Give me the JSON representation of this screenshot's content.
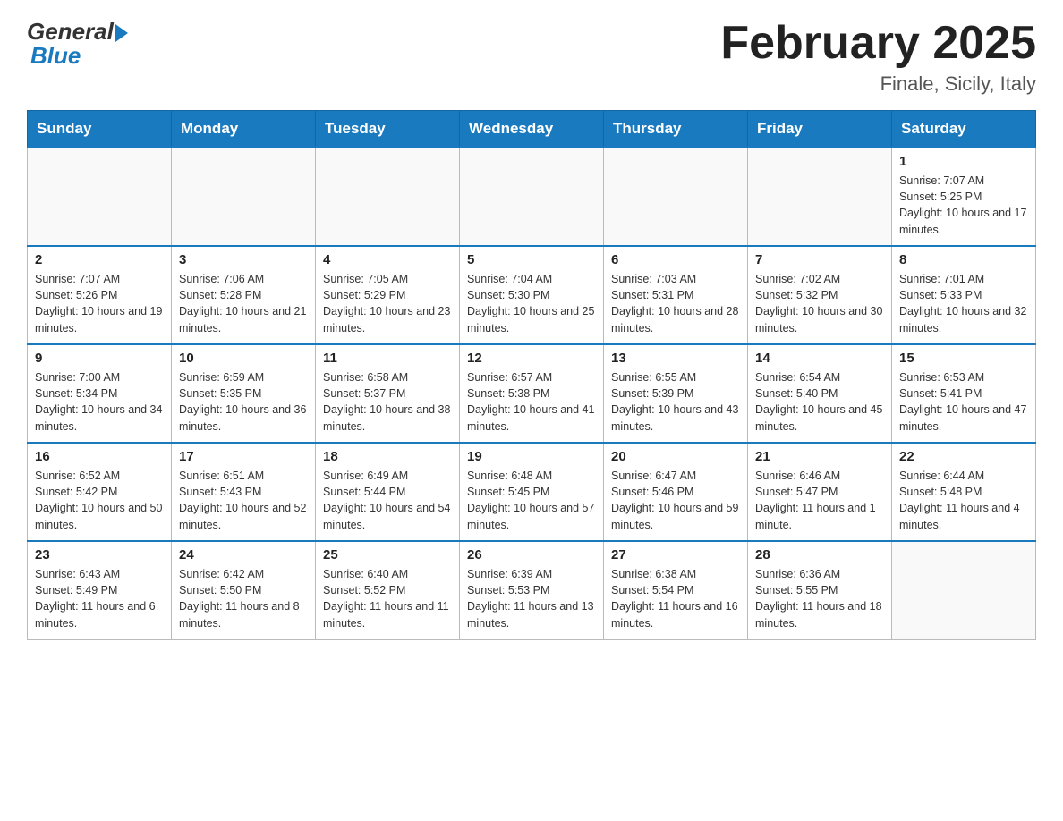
{
  "logo": {
    "general": "General",
    "blue": "Blue"
  },
  "title": "February 2025",
  "location": "Finale, Sicily, Italy",
  "days_of_week": [
    "Sunday",
    "Monday",
    "Tuesday",
    "Wednesday",
    "Thursday",
    "Friday",
    "Saturday"
  ],
  "weeks": [
    [
      {
        "day": "",
        "info": ""
      },
      {
        "day": "",
        "info": ""
      },
      {
        "day": "",
        "info": ""
      },
      {
        "day": "",
        "info": ""
      },
      {
        "day": "",
        "info": ""
      },
      {
        "day": "",
        "info": ""
      },
      {
        "day": "1",
        "info": "Sunrise: 7:07 AM\nSunset: 5:25 PM\nDaylight: 10 hours and 17 minutes."
      }
    ],
    [
      {
        "day": "2",
        "info": "Sunrise: 7:07 AM\nSunset: 5:26 PM\nDaylight: 10 hours and 19 minutes."
      },
      {
        "day": "3",
        "info": "Sunrise: 7:06 AM\nSunset: 5:28 PM\nDaylight: 10 hours and 21 minutes."
      },
      {
        "day": "4",
        "info": "Sunrise: 7:05 AM\nSunset: 5:29 PM\nDaylight: 10 hours and 23 minutes."
      },
      {
        "day": "5",
        "info": "Sunrise: 7:04 AM\nSunset: 5:30 PM\nDaylight: 10 hours and 25 minutes."
      },
      {
        "day": "6",
        "info": "Sunrise: 7:03 AM\nSunset: 5:31 PM\nDaylight: 10 hours and 28 minutes."
      },
      {
        "day": "7",
        "info": "Sunrise: 7:02 AM\nSunset: 5:32 PM\nDaylight: 10 hours and 30 minutes."
      },
      {
        "day": "8",
        "info": "Sunrise: 7:01 AM\nSunset: 5:33 PM\nDaylight: 10 hours and 32 minutes."
      }
    ],
    [
      {
        "day": "9",
        "info": "Sunrise: 7:00 AM\nSunset: 5:34 PM\nDaylight: 10 hours and 34 minutes."
      },
      {
        "day": "10",
        "info": "Sunrise: 6:59 AM\nSunset: 5:35 PM\nDaylight: 10 hours and 36 minutes."
      },
      {
        "day": "11",
        "info": "Sunrise: 6:58 AM\nSunset: 5:37 PM\nDaylight: 10 hours and 38 minutes."
      },
      {
        "day": "12",
        "info": "Sunrise: 6:57 AM\nSunset: 5:38 PM\nDaylight: 10 hours and 41 minutes."
      },
      {
        "day": "13",
        "info": "Sunrise: 6:55 AM\nSunset: 5:39 PM\nDaylight: 10 hours and 43 minutes."
      },
      {
        "day": "14",
        "info": "Sunrise: 6:54 AM\nSunset: 5:40 PM\nDaylight: 10 hours and 45 minutes."
      },
      {
        "day": "15",
        "info": "Sunrise: 6:53 AM\nSunset: 5:41 PM\nDaylight: 10 hours and 47 minutes."
      }
    ],
    [
      {
        "day": "16",
        "info": "Sunrise: 6:52 AM\nSunset: 5:42 PM\nDaylight: 10 hours and 50 minutes."
      },
      {
        "day": "17",
        "info": "Sunrise: 6:51 AM\nSunset: 5:43 PM\nDaylight: 10 hours and 52 minutes."
      },
      {
        "day": "18",
        "info": "Sunrise: 6:49 AM\nSunset: 5:44 PM\nDaylight: 10 hours and 54 minutes."
      },
      {
        "day": "19",
        "info": "Sunrise: 6:48 AM\nSunset: 5:45 PM\nDaylight: 10 hours and 57 minutes."
      },
      {
        "day": "20",
        "info": "Sunrise: 6:47 AM\nSunset: 5:46 PM\nDaylight: 10 hours and 59 minutes."
      },
      {
        "day": "21",
        "info": "Sunrise: 6:46 AM\nSunset: 5:47 PM\nDaylight: 11 hours and 1 minute."
      },
      {
        "day": "22",
        "info": "Sunrise: 6:44 AM\nSunset: 5:48 PM\nDaylight: 11 hours and 4 minutes."
      }
    ],
    [
      {
        "day": "23",
        "info": "Sunrise: 6:43 AM\nSunset: 5:49 PM\nDaylight: 11 hours and 6 minutes."
      },
      {
        "day": "24",
        "info": "Sunrise: 6:42 AM\nSunset: 5:50 PM\nDaylight: 11 hours and 8 minutes."
      },
      {
        "day": "25",
        "info": "Sunrise: 6:40 AM\nSunset: 5:52 PM\nDaylight: 11 hours and 11 minutes."
      },
      {
        "day": "26",
        "info": "Sunrise: 6:39 AM\nSunset: 5:53 PM\nDaylight: 11 hours and 13 minutes."
      },
      {
        "day": "27",
        "info": "Sunrise: 6:38 AM\nSunset: 5:54 PM\nDaylight: 11 hours and 16 minutes."
      },
      {
        "day": "28",
        "info": "Sunrise: 6:36 AM\nSunset: 5:55 PM\nDaylight: 11 hours and 18 minutes."
      },
      {
        "day": "",
        "info": ""
      }
    ]
  ]
}
